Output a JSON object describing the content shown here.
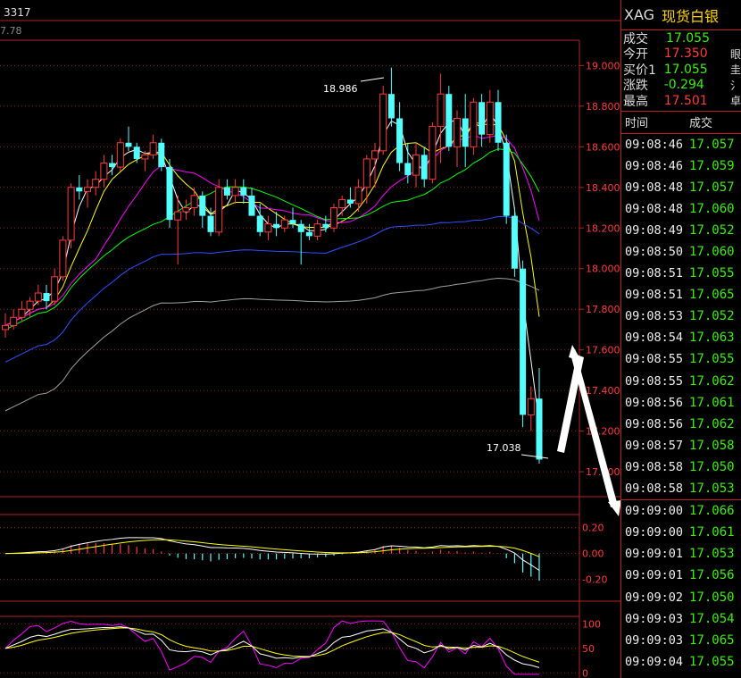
{
  "header": {
    "code": "3317",
    "sub_value": "7.78"
  },
  "quote": {
    "symbol": "XAG",
    "name": "现货白银",
    "rows": [
      {
        "label": "成交",
        "value": "17.055",
        "color": "green",
        "edge": ""
      },
      {
        "label": "今开",
        "value": "17.350",
        "color": "red",
        "edge": "眼"
      },
      {
        "label": "买价1",
        "value": "17.055",
        "color": "green",
        "edge": "圭"
      },
      {
        "label": "涨跌",
        "value": "-0.294",
        "color": "green",
        "edge": "氵"
      },
      {
        "label": "最高",
        "value": "17.501",
        "color": "red",
        "edge": "卓"
      }
    ],
    "trades_header": {
      "time": "时间",
      "price": "成交"
    },
    "trades": [
      [
        "09:08:46",
        "17.057"
      ],
      [
        "09:08:46",
        "17.059"
      ],
      [
        "09:08:48",
        "17.057"
      ],
      [
        "09:08:48",
        "17.060"
      ],
      [
        "09:08:49",
        "17.052"
      ],
      [
        "09:08:50",
        "17.060"
      ],
      [
        "09:08:51",
        "17.055"
      ],
      [
        "09:08:51",
        "17.065"
      ],
      [
        "09:08:53",
        "17.052"
      ],
      [
        "09:08:54",
        "17.063"
      ],
      [
        "09:08:55",
        "17.055"
      ],
      [
        "09:08:55",
        "17.062"
      ],
      [
        "09:08:56",
        "17.061"
      ],
      [
        "09:08:56",
        "17.062"
      ],
      [
        "09:08:57",
        "17.058"
      ],
      [
        "09:08:58",
        "17.050"
      ],
      [
        "09:08:58",
        "17.053"
      ],
      [
        "09:09:00",
        "17.066"
      ],
      [
        "09:09:00",
        "17.061"
      ],
      [
        "09:09:01",
        "17.053"
      ],
      [
        "09:09:01",
        "17.056"
      ],
      [
        "09:09:02",
        "17.050"
      ],
      [
        "09:09:03",
        "17.054"
      ],
      [
        "09:09:03",
        "17.065"
      ],
      [
        "09:09:04",
        "17.055"
      ]
    ]
  },
  "chart_data": {
    "type": "candlestick",
    "main": {
      "y_ticks": [
        "19.000",
        "18.800",
        "18.600",
        "18.400",
        "18.200",
        "18.000",
        "17.800",
        "17.600",
        "17.400",
        "17.200",
        "17.000"
      ],
      "ylim": [
        16.93,
        19.05
      ],
      "high_label": "18.986",
      "low_label": "17.038",
      "candles": [
        [
          17.7,
          17.78,
          17.66,
          17.72
        ],
        [
          17.72,
          17.8,
          17.7,
          17.76
        ],
        [
          17.76,
          17.84,
          17.74,
          17.8
        ],
        [
          17.8,
          17.86,
          17.76,
          17.84
        ],
        [
          17.84,
          17.92,
          17.82,
          17.88
        ],
        [
          17.88,
          17.92,
          17.8,
          17.84
        ],
        [
          17.84,
          18.0,
          17.82,
          17.96
        ],
        [
          17.96,
          18.16,
          17.94,
          18.14
        ],
        [
          18.14,
          18.42,
          18.1,
          18.4
        ],
        [
          18.4,
          18.46,
          18.34,
          18.38
        ],
        [
          18.38,
          18.44,
          18.3,
          18.4
        ],
        [
          18.4,
          18.48,
          18.36,
          18.44
        ],
        [
          18.44,
          18.56,
          18.4,
          18.52
        ],
        [
          18.52,
          18.56,
          18.46,
          18.5
        ],
        [
          18.5,
          18.64,
          18.48,
          18.62
        ],
        [
          18.62,
          18.7,
          18.58,
          18.6
        ],
        [
          18.6,
          18.62,
          18.52,
          18.54
        ],
        [
          18.54,
          18.58,
          18.48,
          18.56
        ],
        [
          18.56,
          18.66,
          18.54,
          18.62
        ],
        [
          18.62,
          18.64,
          18.48,
          18.5
        ],
        [
          18.5,
          18.54,
          18.2,
          18.24
        ],
        [
          18.24,
          18.36,
          18.02,
          18.28
        ],
        [
          18.28,
          18.34,
          18.24,
          18.3
        ],
        [
          18.3,
          18.4,
          18.26,
          18.36
        ],
        [
          18.36,
          18.38,
          18.2,
          18.26
        ],
        [
          18.26,
          18.3,
          18.16,
          18.18
        ],
        [
          18.18,
          18.44,
          18.16,
          18.4
        ],
        [
          18.4,
          18.44,
          18.34,
          18.36
        ],
        [
          18.36,
          18.44,
          18.32,
          18.4
        ],
        [
          18.4,
          18.44,
          18.32,
          18.36
        ],
        [
          18.36,
          18.4,
          18.3,
          18.26
        ],
        [
          18.26,
          18.32,
          18.16,
          18.18
        ],
        [
          18.18,
          18.26,
          18.14,
          18.22
        ],
        [
          18.22,
          18.28,
          18.16,
          18.2
        ],
        [
          18.2,
          18.26,
          18.18,
          18.24
        ],
        [
          18.24,
          18.3,
          18.2,
          18.22
        ],
        [
          18.22,
          18.24,
          18.02,
          18.18
        ],
        [
          18.18,
          18.22,
          18.14,
          18.16
        ],
        [
          18.16,
          18.24,
          18.14,
          18.22
        ],
        [
          18.22,
          18.26,
          18.18,
          18.2
        ],
        [
          18.2,
          18.32,
          18.18,
          18.3
        ],
        [
          18.3,
          18.36,
          18.26,
          18.34
        ],
        [
          18.34,
          18.4,
          18.3,
          18.32
        ],
        [
          18.32,
          18.44,
          18.28,
          18.4
        ],
        [
          18.4,
          18.56,
          18.32,
          18.54
        ],
        [
          18.54,
          18.62,
          18.4,
          18.58
        ],
        [
          18.58,
          18.9,
          18.56,
          18.86
        ],
        [
          18.86,
          18.99,
          18.7,
          18.74
        ],
        [
          18.74,
          18.82,
          18.48,
          18.52
        ],
        [
          18.52,
          18.62,
          18.42,
          18.46
        ],
        [
          18.46,
          18.62,
          18.4,
          18.56
        ],
        [
          18.56,
          18.6,
          18.4,
          18.44
        ],
        [
          18.44,
          18.72,
          18.42,
          18.7
        ],
        [
          18.7,
          18.96,
          18.52,
          18.86
        ],
        [
          18.86,
          18.9,
          18.58,
          18.6
        ],
        [
          18.6,
          18.78,
          18.5,
          18.74
        ],
        [
          18.74,
          18.86,
          18.5,
          18.6
        ],
        [
          18.6,
          18.84,
          18.56,
          18.82
        ],
        [
          18.82,
          18.86,
          18.6,
          18.66
        ],
        [
          18.66,
          18.88,
          18.62,
          18.82
        ],
        [
          18.82,
          18.88,
          18.58,
          18.62
        ],
        [
          18.62,
          18.66,
          18.22,
          18.26
        ],
        [
          18.26,
          18.3,
          17.96,
          18.0
        ],
        [
          18.0,
          18.04,
          17.22,
          17.28
        ],
        [
          17.28,
          17.42,
          17.2,
          17.36
        ],
        [
          17.36,
          17.51,
          17.04,
          17.06
        ]
      ],
      "ma_colors": [
        "#ffffff",
        "#ffff00",
        "#ff00ff",
        "#00ff00",
        "#3050ff",
        "#a0a0a0"
      ]
    },
    "macd": {
      "y_ticks": [
        "0.20",
        "0.00",
        "-0.20"
      ],
      "ylim": [
        -0.32,
        0.26
      ]
    },
    "kdj": {
      "y_ticks": [
        "100",
        "50",
        "0"
      ],
      "ylim": [
        -5,
        108
      ]
    },
    "colors": {
      "grid_border": "#b22222",
      "up": "#ff3c3c",
      "down": "#54ffff",
      "arrow": "#ffffff"
    }
  }
}
